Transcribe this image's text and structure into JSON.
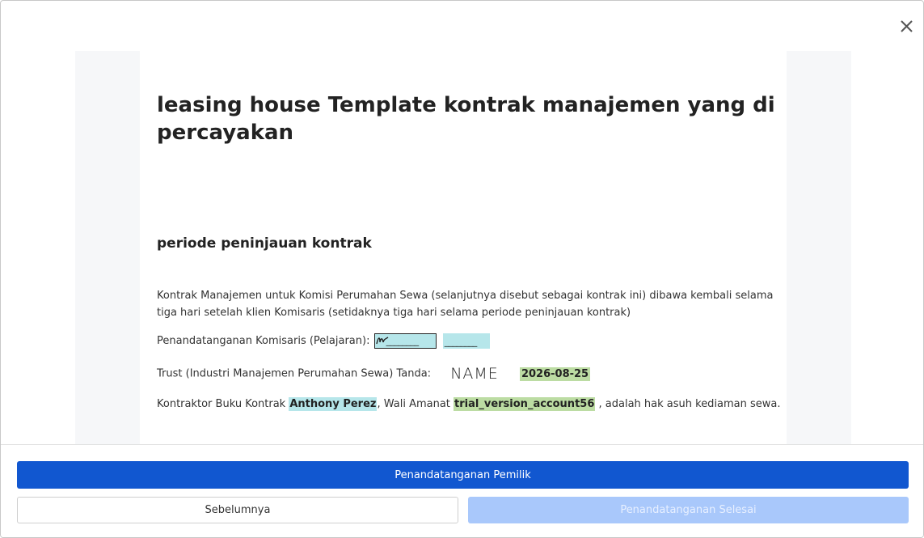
{
  "modal": {
    "close_icon": "close-icon"
  },
  "document": {
    "title": "leasing house Template kontrak manajemen yang dipercayakan",
    "section_title": "periode peninjauan kontrak",
    "paragraph": "Kontrak Manajemen untuk Komisi Perumahan Sewa (selanjutnya disebut sebagai kontrak ini) dibawa kembali selama tiga hari setelah klien Komisaris (setidaknya tiga hari selama periode peninjauan kontrak)",
    "signer_line": {
      "label": "Penandatanganan Komisaris (Pelajaran):",
      "field1_underscores": "________",
      "field2_underscores": "________"
    },
    "trust_line": {
      "label": "Trust (Industri Manajemen Perumahan Sewa) Tanda:",
      "name_placeholder": "NAME",
      "date": "2026-08-25"
    },
    "contractor_line": {
      "prefix": "Kontraktor Buku Kontrak ",
      "contractor_name": "Anthony Perez",
      "middle": ", Wali Amanat ",
      "trustee_name": "trial_version_account56",
      "suffix": " , adalah hak asuh kediaman sewa."
    }
  },
  "footer": {
    "primary_label": "Penandatanganan Pemilik",
    "previous_label": "Sebelumnya",
    "done_label": "Penandatanganan Selesai"
  },
  "colors": {
    "primary": "#1157d0",
    "disabled": "#a9c8fb",
    "field_cyan": "#b6e6ea",
    "field_green": "#bcdca3"
  }
}
